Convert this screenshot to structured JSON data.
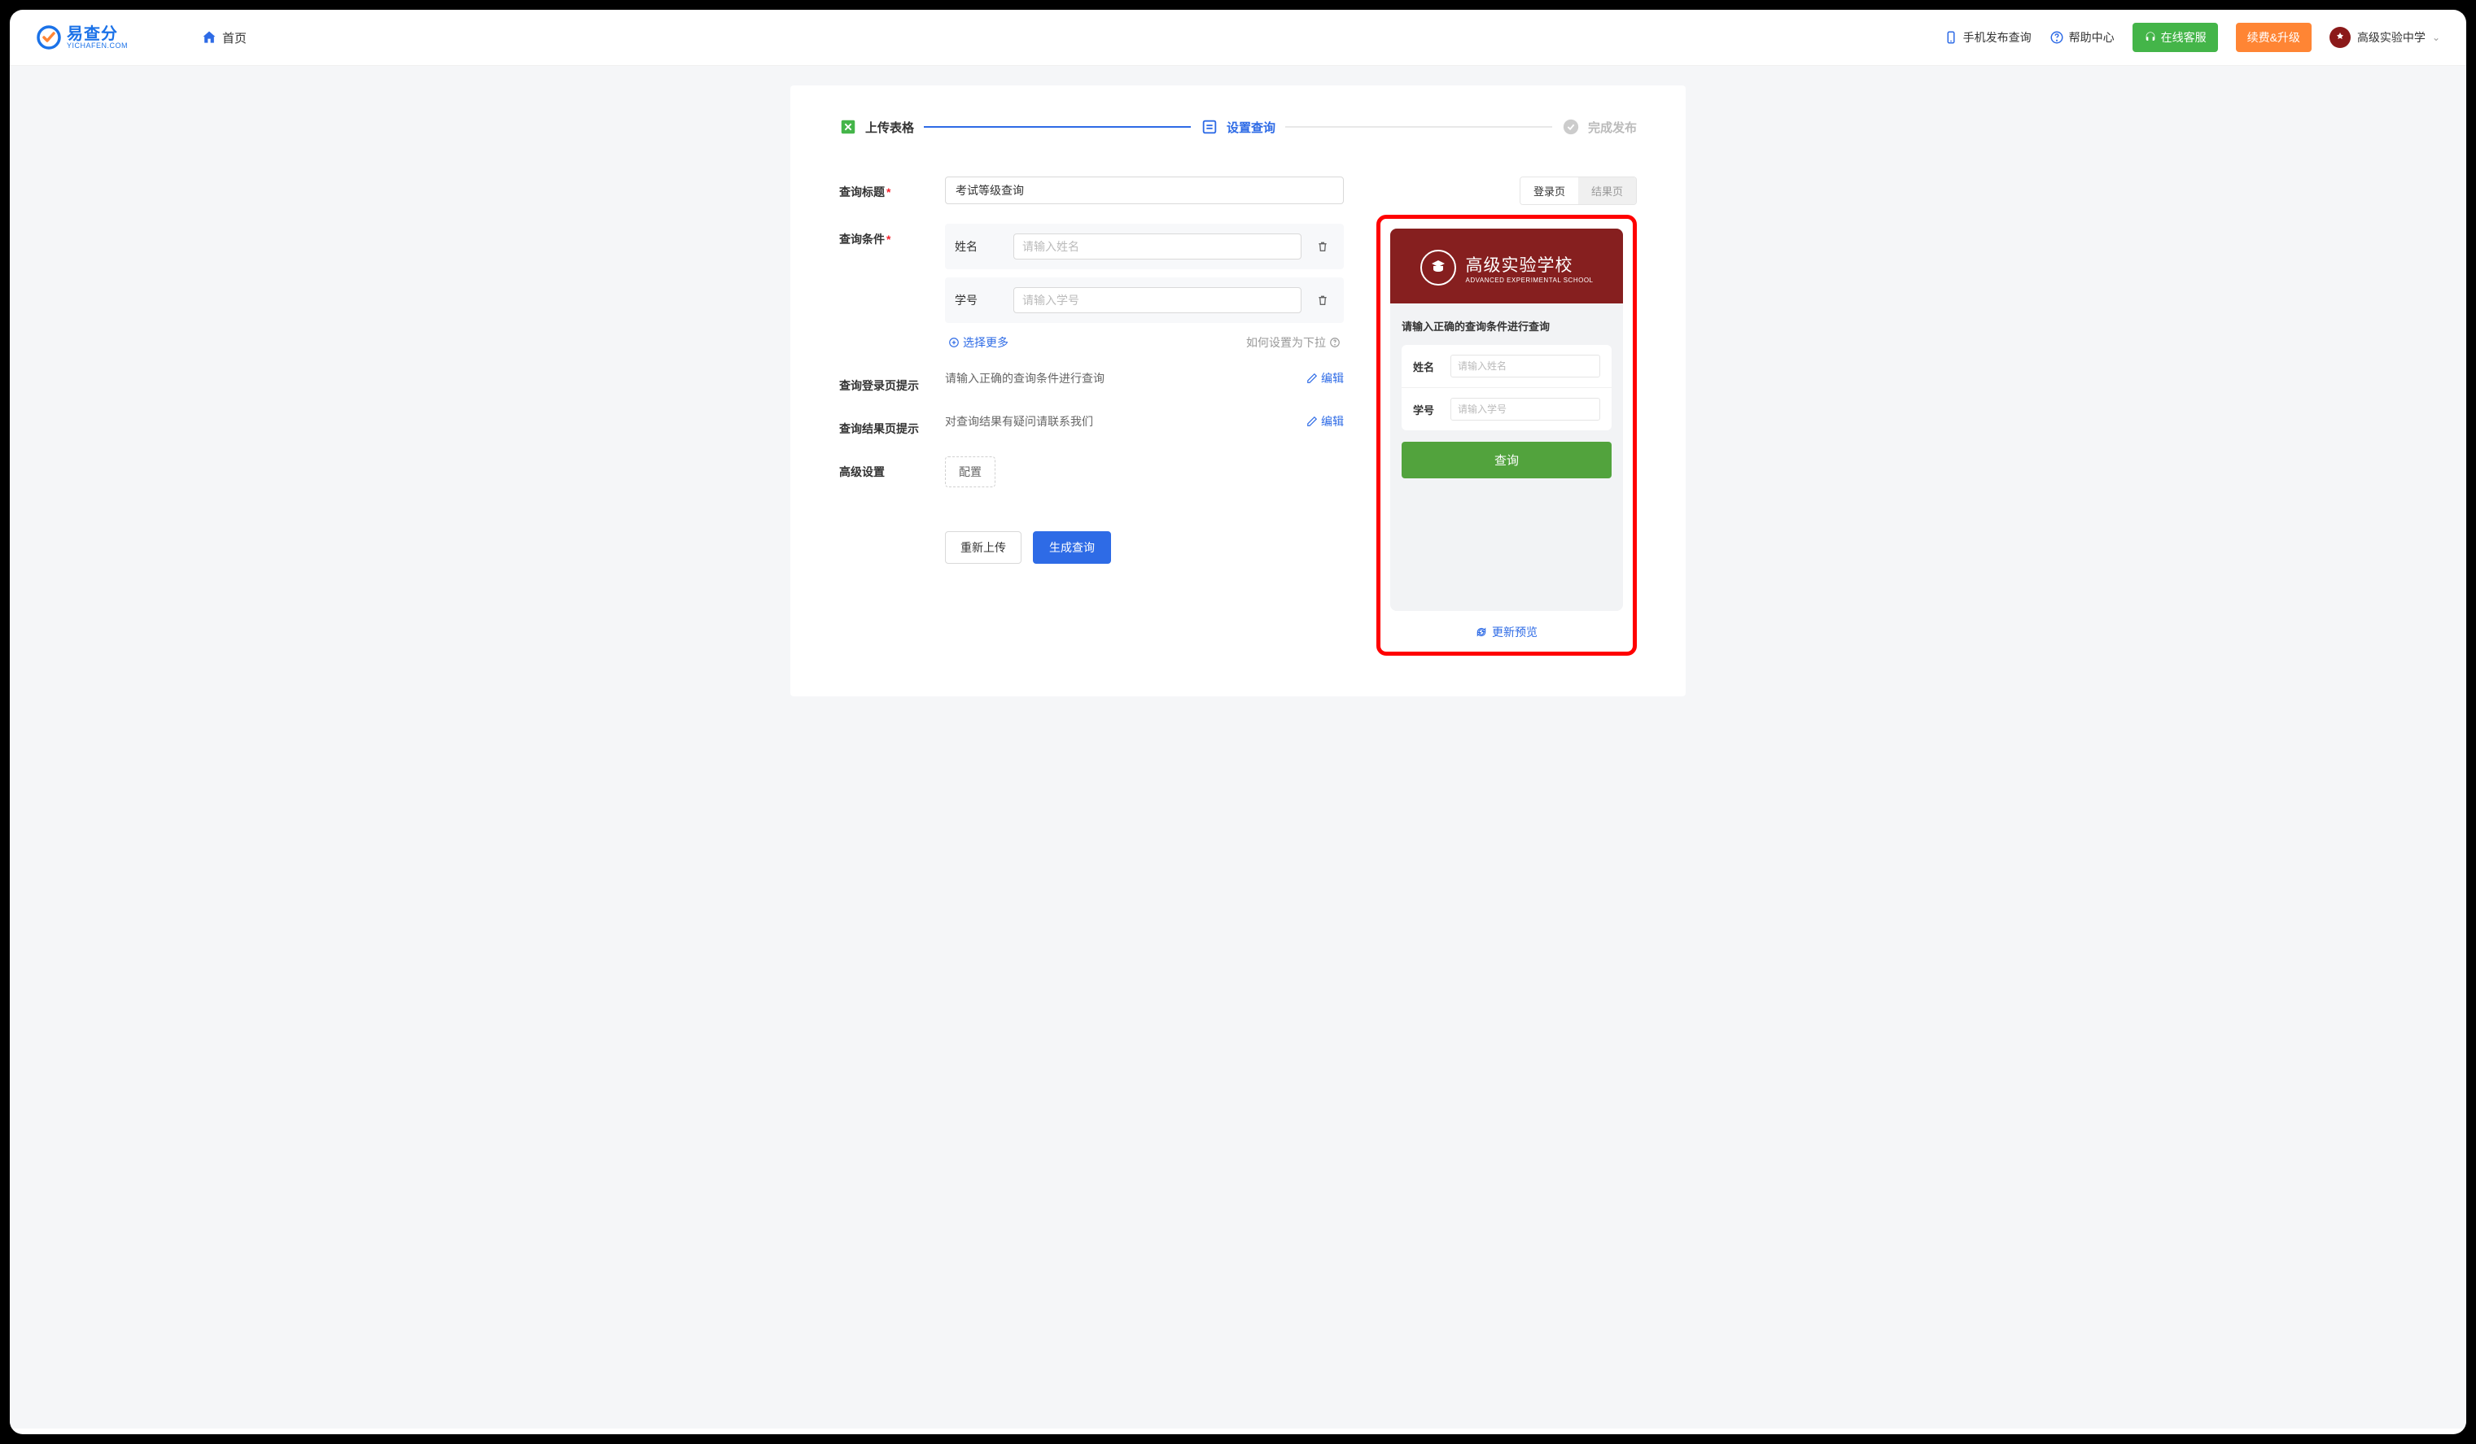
{
  "header": {
    "logo_cn": "易查分",
    "logo_en": "YICHAFEN.COM",
    "nav_home": "首页",
    "mobile_publish": "手机发布查询",
    "help_center": "帮助中心",
    "online_service": "在线客服",
    "renew_upgrade": "续费&升级",
    "user_name": "高级实验中学"
  },
  "stepper": {
    "step1": "上传表格",
    "step2": "设置查询",
    "step3": "完成发布"
  },
  "form": {
    "title_label": "查询标题",
    "title_value": "考试等级查询",
    "conditions_label": "查询条件",
    "cond1_label": "姓名",
    "cond1_placeholder": "请输入姓名",
    "cond2_label": "学号",
    "cond2_placeholder": "请输入学号",
    "select_more": "选择更多",
    "dropdown_hint": "如何设置为下拉",
    "login_hint_label": "查询登录页提示",
    "login_hint_value": "请输入正确的查询条件进行查询",
    "result_hint_label": "查询结果页提示",
    "result_hint_value": "对查询结果有疑问请联系我们",
    "edit_label": "编辑",
    "advanced_label": "高级设置",
    "config_label": "配置",
    "reupload": "重新上传",
    "generate": "生成查询"
  },
  "preview": {
    "tab_login": "登录页",
    "tab_result": "结果页",
    "school_cn": "高级实验学校",
    "school_en": "ADVANCED EXPERIMENTAL SCHOOL",
    "hint": "请输入正确的查询条件进行查询",
    "field1_label": "姓名",
    "field1_placeholder": "请输入姓名",
    "field2_label": "学号",
    "field2_placeholder": "请输入学号",
    "submit": "查询",
    "refresh": "更新预览"
  }
}
